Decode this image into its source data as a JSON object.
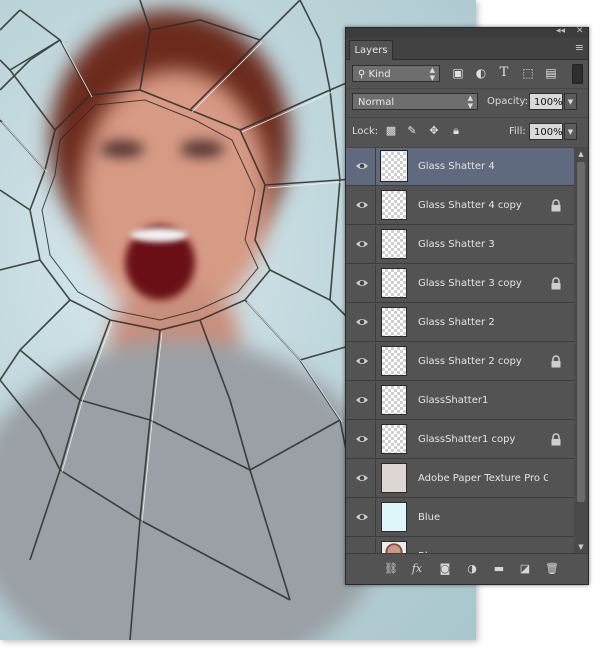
{
  "panel": {
    "title_tab": "Layers",
    "filter": {
      "kind_label": "Kind",
      "icons": [
        "image-filter-icon",
        "adjustment-filter-icon",
        "type-filter-icon",
        "shape-filter-icon",
        "smart-object-filter-icon"
      ]
    },
    "blend_mode": "Normal",
    "opacity_label": "Opacity:",
    "opacity_value": "100%",
    "lock_label": "Lock:",
    "fill_label": "Fill:",
    "fill_value": "100%",
    "layers": [
      {
        "name": "Glass Shatter 4",
        "selected": true,
        "locked": false,
        "thumb": "transparent"
      },
      {
        "name": "Glass Shatter 4 copy",
        "selected": false,
        "locked": true,
        "thumb": "transparent"
      },
      {
        "name": "Glass Shatter 3",
        "selected": false,
        "locked": false,
        "thumb": "transparent"
      },
      {
        "name": "Glass Shatter 3 copy",
        "selected": false,
        "locked": true,
        "thumb": "transparent"
      },
      {
        "name": "Glass Shatter 2",
        "selected": false,
        "locked": false,
        "thumb": "transparent"
      },
      {
        "name": "Glass Shatter 2 copy",
        "selected": false,
        "locked": true,
        "thumb": "transparent"
      },
      {
        "name": "GlassShatter1",
        "selected": false,
        "locked": false,
        "thumb": "transparent"
      },
      {
        "name": "GlassShatter1 copy",
        "selected": false,
        "locked": true,
        "thumb": "transparent"
      },
      {
        "name": "Adobe Paper Texture Pro Ge...",
        "selected": false,
        "locked": false,
        "thumb": "paper"
      },
      {
        "name": "Blue",
        "selected": false,
        "locked": false,
        "thumb": "blue"
      },
      {
        "name": "Blue",
        "selected": false,
        "locked": false,
        "thumb": "photo"
      }
    ],
    "bottom_icons": [
      "link-layers-icon",
      "fx-icon",
      "add-mask-icon",
      "adjustment-layer-icon",
      "new-group-icon",
      "new-layer-icon",
      "delete-layer-icon"
    ]
  },
  "colors": {
    "panel_bg": "#535353",
    "selected_row": "#5f6a7f",
    "canvas_bg": "#bed6dc"
  }
}
